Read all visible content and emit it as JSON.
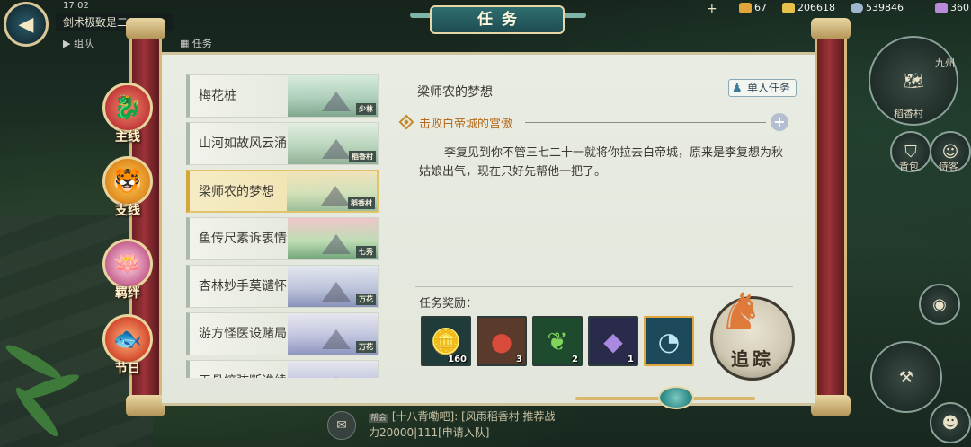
{
  "window": {
    "title": "任务"
  },
  "hud": {
    "back_icon": "back-arrow-icon",
    "time": "17:02",
    "guild_name": "剑术极致是二",
    "team_label": "组队",
    "task_label": "任务",
    "currencies": [
      {
        "icon": "gold-ingot-icon",
        "value": "67",
        "color": "#e0a63b"
      },
      {
        "icon": "crown-icon",
        "value": "206618",
        "color": "#e6c24a"
      },
      {
        "icon": "silver-coin-icon",
        "value": "539846",
        "color": "#9fb6cf"
      },
      {
        "icon": "gem-icon",
        "value": "360",
        "color": "#b88ad8"
      }
    ]
  },
  "categories": [
    {
      "label": "主线",
      "icon": "dragon-icon",
      "color": "#c23a3a"
    },
    {
      "label": "支线",
      "icon": "tiger-icon",
      "color": "#e08a1e"
    },
    {
      "label": "羁绊",
      "icon": "lotus-crane-icon",
      "color": "#c35a8a"
    },
    {
      "label": "节日",
      "icon": "carp-icon",
      "color": "#d44a2e"
    }
  ],
  "quests": [
    {
      "name": "梅花桩",
      "tag": "少林",
      "active": false
    },
    {
      "name": "山河如故风云涌",
      "tag": "稻香村",
      "active": false
    },
    {
      "name": "梁师农的梦想",
      "tag": "稻香村",
      "active": true
    },
    {
      "name": "鱼传尺素诉衷情",
      "tag": "七秀",
      "active": false
    },
    {
      "name": "杏林妙手莫谴怀",
      "tag": "万花",
      "active": false
    },
    {
      "name": "游方怪医设赌局",
      "tag": "万花",
      "active": false
    },
    {
      "name": "无骨悴弦断谁续",
      "tag": "",
      "active": false
    }
  ],
  "detail": {
    "title": "梁师农的梦想",
    "type_badge": "单人任务",
    "objective": "击败白帝城的宫傲",
    "description": "李复见到你不管三七二十一就将你拉去白帝城，原来是李复想为秋姑娘出气，现在只好先帮他一把了。",
    "reward_label": "任务奖励：",
    "rewards": [
      {
        "icon": "gold-ingot-icon",
        "count": "160",
        "color": "#1f3b3a"
      },
      {
        "icon": "red-fruit-icon",
        "count": "3",
        "color": "#5a3a2a"
      },
      {
        "icon": "green-vegetable-icon",
        "count": "2",
        "color": "#1e4a2e"
      },
      {
        "icon": "purple-crystal-icon",
        "count": "1",
        "color": "#2a2a4a"
      },
      {
        "icon": "wind-skill-icon",
        "count": "",
        "color": "#1c4a5a"
      }
    ],
    "track_label": "追踪"
  },
  "side": {
    "village_label": "稻香村",
    "bag_label": "背包",
    "servant_label": "侍客",
    "map_label": "九州"
  },
  "chat": {
    "line1": "[十八背嘞吧]: [风雨稻香村 推荐战",
    "line2": "力20000|111[申请入队]",
    "tag": "帮会"
  }
}
